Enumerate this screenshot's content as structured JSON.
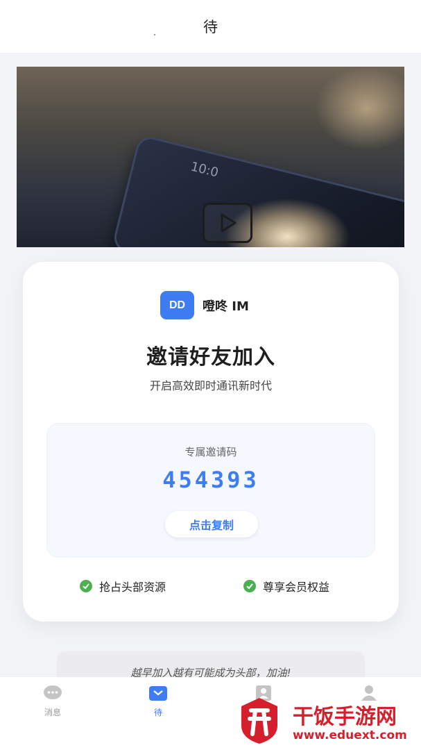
{
  "header": {
    "title": "待"
  },
  "video": {
    "screen_time": "10:0"
  },
  "card": {
    "brand_logo": "DD",
    "brand_name": "噔咚 IM",
    "heading": "邀请好友加入",
    "subheading": "开启高效即时通讯新时代",
    "code_label": "专属邀请码",
    "invite_code": "454393",
    "copy_button": "点击复制",
    "benefits": [
      "抢占头部资源",
      "尊享会员权益"
    ]
  },
  "footer_note": "越早加入越有可能成为头部，加油!",
  "tabbar": {
    "tabs": [
      {
        "label": "消息",
        "icon": "chat-bubble-icon"
      },
      {
        "label": "待",
        "icon": "inbox-icon"
      },
      {
        "label": "",
        "icon": "contacts-icon"
      },
      {
        "label": "",
        "icon": "profile-icon"
      }
    ],
    "active_color": "#3e7cf2"
  },
  "watermark": {
    "title": "干饭手游网",
    "url": "www.eduext.com"
  },
  "colors": {
    "accent": "#3e7cf2",
    "success": "#4caf50",
    "watermark": "#d61f2c"
  }
}
